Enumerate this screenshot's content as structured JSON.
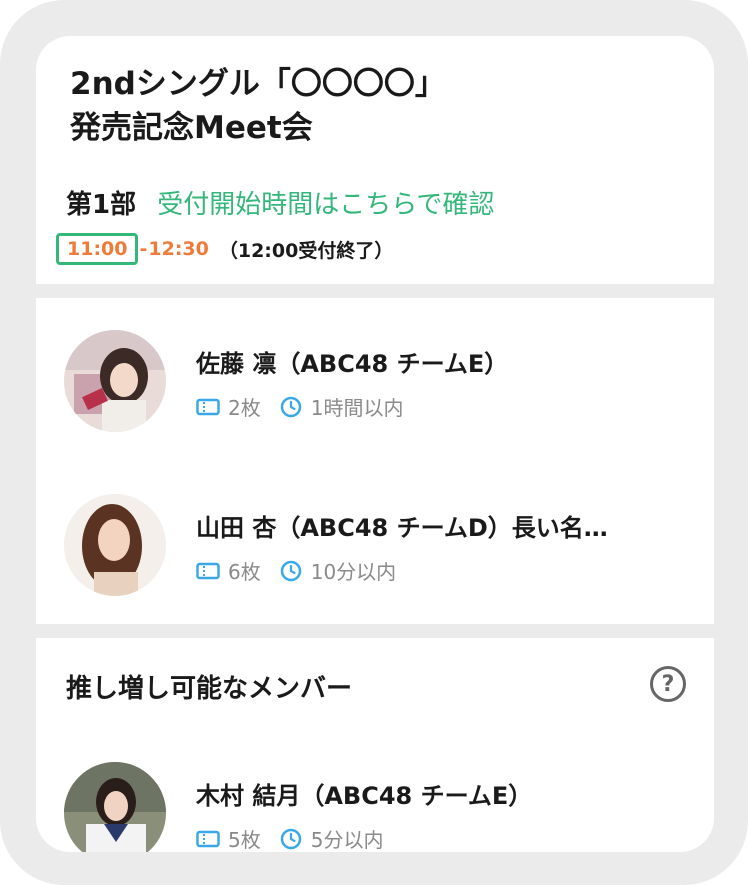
{
  "event": {
    "title_line1": "2ndシングル「〇〇〇〇」",
    "title_line2": "発売記念Meet会"
  },
  "session": {
    "label": "第1部",
    "link_text": "受付開始時間はこちらで確認",
    "time_start": "11:00",
    "time_separator": "-",
    "time_end": "12:30",
    "time_note": "（12:00受付終了）"
  },
  "members": [
    {
      "name": "佐藤 凛（ABC48 チームE）",
      "tickets": "2枚",
      "wait": "1時間以内"
    },
    {
      "name": "山田 杏（ABC48 チームD）長い名…",
      "tickets": "6枚",
      "wait": "10分以内"
    }
  ],
  "boost": {
    "title": "推し増し可能なメンバー",
    "help_symbol": "?",
    "members": [
      {
        "name": "木村 結月（ABC48 チームE）",
        "tickets": "5枚",
        "wait": "5分以内"
      }
    ]
  },
  "colors": {
    "accent_green": "#33b87a",
    "time_orange": "#f07a3a",
    "icon_blue": "#3aa8e8",
    "frame_gray": "#ebebeb"
  }
}
